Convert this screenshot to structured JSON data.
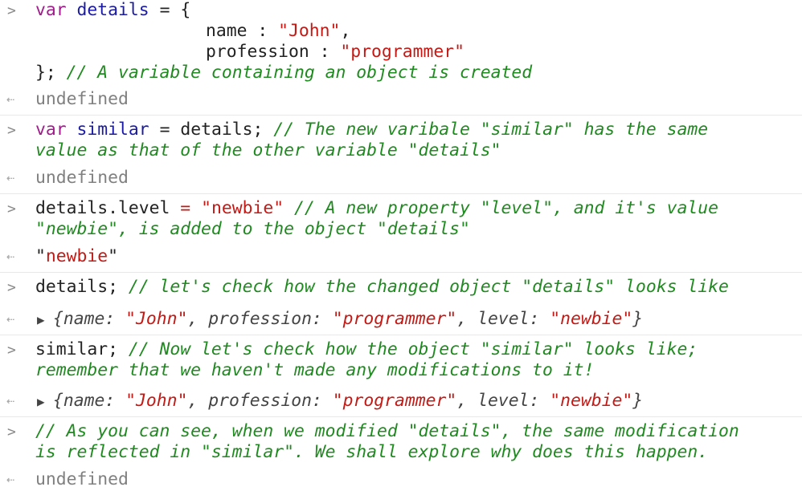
{
  "console": {
    "entry1": {
      "l1": {
        "kw": "var",
        "id": "details",
        "rest": " = {"
      },
      "l2": {
        "key": "name : ",
        "val": "\"John\"",
        "tail": ","
      },
      "l3": {
        "key": "profession : ",
        "val": "\"programmer\""
      },
      "l4": {
        "pre": "}; ",
        "comment": "// A variable containing an object is created"
      },
      "result": "undefined"
    },
    "entry2": {
      "l1": {
        "kw": "var",
        "id": "similar",
        "mid": " = details; ",
        "comment": "// The new varibale \"similar\" has the same"
      },
      "l2": {
        "comment": "value as that of the other variable \"details\""
      },
      "result": "undefined"
    },
    "entry3": {
      "l1": {
        "pre": "details.level ",
        "eq": "=",
        "sp": " ",
        "val": "\"newbie\"",
        "comment": " // A new property \"level\", and it's value"
      },
      "l2": {
        "comment": "\"newbie\", is added to the object \"details\""
      },
      "result": {
        "q1": "\"",
        "val": "newbie",
        "q2": "\""
      }
    },
    "entry4": {
      "l1": {
        "pre": "details; ",
        "comment": "// let's check how the changed object \"details\" looks like"
      },
      "result": {
        "open": "{",
        "k1": "name: ",
        "v1": "\"John\"",
        "c1": ", ",
        "k2": "profession: ",
        "v2": "\"programmer\"",
        "c2": ", ",
        "k3": "level: ",
        "v3": "\"newbie\"",
        "close": "}"
      }
    },
    "entry5": {
      "l1": {
        "pre": "similar; ",
        "comment": "// Now let's check how the object \"similar\" looks like;"
      },
      "l2": {
        "comment": "remember that we haven't made any modifications to it!"
      },
      "result": {
        "open": "{",
        "k1": "name: ",
        "v1": "\"John\"",
        "c1": ", ",
        "k2": "profession: ",
        "v2": "\"programmer\"",
        "c2": ", ",
        "k3": "level: ",
        "v3": "\"newbie\"",
        "close": "}"
      }
    },
    "entry6": {
      "l1": {
        "comment": "// As you can see, when we modified \"details\", the same modification"
      },
      "l2": {
        "comment": "is reflected in \"similar\". We shall explore why does this happen."
      },
      "result": "undefined"
    }
  },
  "icons": {
    "prompt": "chevron-right-icon",
    "result": "return-arrow-icon",
    "expand": "disclosure-triangle-icon"
  },
  "colors": {
    "keyword": "#a11d8c",
    "identifier": "#1a1aa6",
    "string": "#c41a16",
    "comment": "#1f8a1f",
    "undefined": "#808080",
    "divider": "#e8e8e8"
  }
}
